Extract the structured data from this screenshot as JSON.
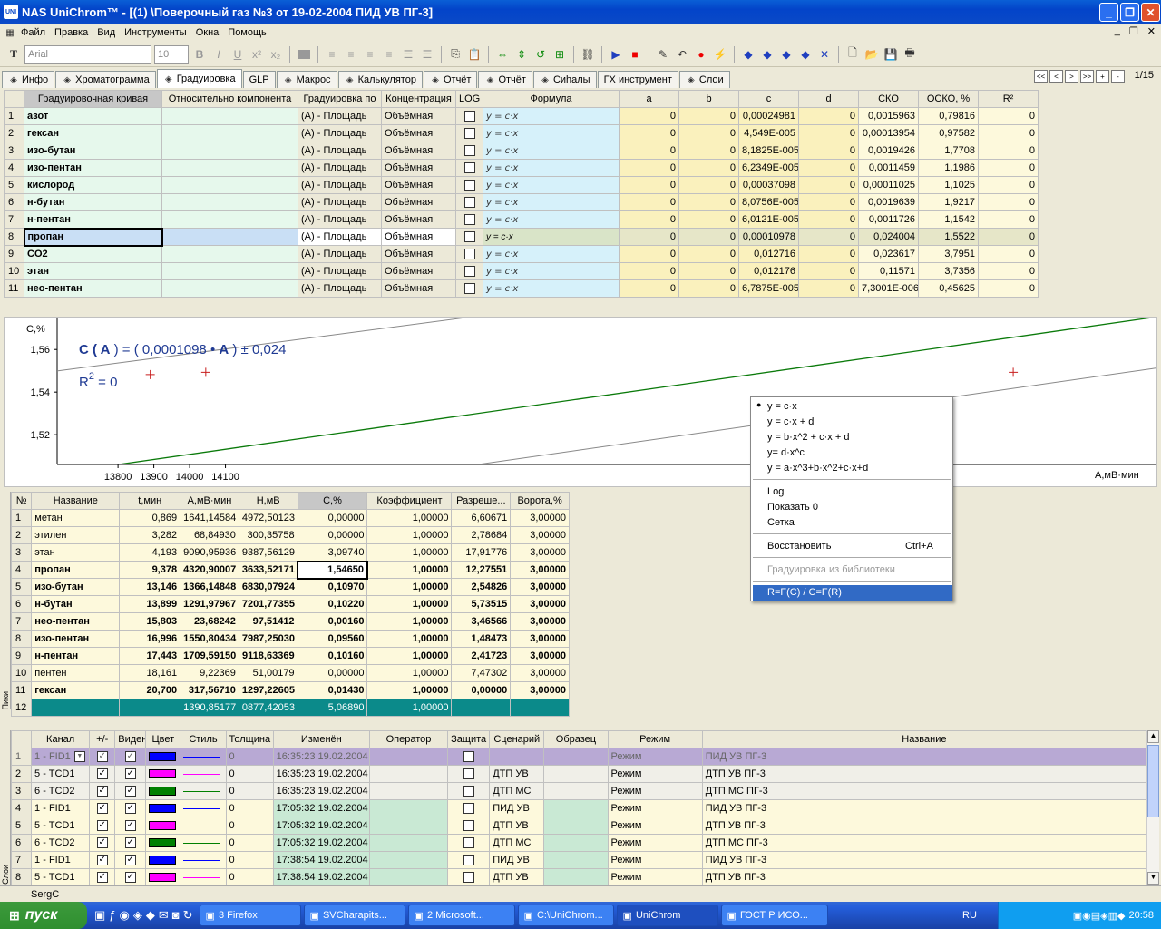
{
  "window": {
    "title": "NAS UniChrom™ - [(1) \\Поверочный газ  №3  от 19-02-2004 ПИД УВ ПГ-3]",
    "app_icon": "UNI"
  },
  "menu": [
    "Файл",
    "Правка",
    "Вид",
    "Инструменты",
    "Окна",
    "Помощь"
  ],
  "toolbar": {
    "font": "Arial",
    "size": "10"
  },
  "tabs": [
    {
      "label": "Инфо",
      "icon": "info-icon",
      "active": false
    },
    {
      "label": "Хроматограмма",
      "icon": "chromatogram-icon",
      "active": false
    },
    {
      "label": "Градуировка",
      "icon": "calibration-icon",
      "active": true
    },
    {
      "label": "GLP",
      "icon": "",
      "active": false
    },
    {
      "label": "Макрос",
      "icon": "macro-icon",
      "active": false
    },
    {
      "label": "Калькулятор",
      "icon": "calculator-icon",
      "active": false
    },
    {
      "label": "Отчёт",
      "icon": "report-icon",
      "active": false
    },
    {
      "label": "Отчёт",
      "icon": "report-icon",
      "active": false
    },
    {
      "label": "Сиhалы",
      "icon": "signals-icon",
      "active": false
    },
    {
      "label": "ГХ инструмент",
      "icon": "",
      "active": false
    },
    {
      "label": "Слои",
      "icon": "layers-icon",
      "active": false
    }
  ],
  "pager": {
    "buttons": [
      "<<",
      "<",
      ">",
      ">>",
      "+",
      "-"
    ],
    "count": "1/15"
  },
  "calib": {
    "headers": [
      "Градуировочная кривая",
      "Относительно компонента",
      "Градуировка по",
      "Концентрация",
      "LOG",
      "Формула",
      "a",
      "b",
      "c",
      "d",
      "СКО",
      "ОСКО, %",
      "R²"
    ],
    "rows": [
      [
        "1",
        "азот",
        "",
        "(A) - Площадь",
        "Объёмная",
        "",
        "y = c·x",
        "0",
        "0",
        "0,00024981",
        "0",
        "0,0015963",
        "0,79816",
        "0"
      ],
      [
        "2",
        "гексан",
        "",
        "(A) - Площадь",
        "Объёмная",
        "",
        "y = c·x",
        "0",
        "0",
        "4,549E-005",
        "0",
        "0,00013954",
        "0,97582",
        "0"
      ],
      [
        "3",
        "изо-бутан",
        "",
        "(A) - Площадь",
        "Объёмная",
        "",
        "y = c·x",
        "0",
        "0",
        "8,1825E-005",
        "0",
        "0,0019426",
        "1,7708",
        "0"
      ],
      [
        "4",
        "изо-пентан",
        "",
        "(A) - Площадь",
        "Объёмная",
        "",
        "y = c·x",
        "0",
        "0",
        "6,2349E-005",
        "0",
        "0,0011459",
        "1,1986",
        "0"
      ],
      [
        "5",
        "кислород",
        "",
        "(A) - Площадь",
        "Объёмная",
        "",
        "y = c·x",
        "0",
        "0",
        "0,00037098",
        "0",
        "0,00011025",
        "1,1025",
        "0"
      ],
      [
        "6",
        "н-бутан",
        "",
        "(A) - Площадь",
        "Объёмная",
        "",
        "y = c·x",
        "0",
        "0",
        "8,0756E-005",
        "0",
        "0,0019639",
        "1,9217",
        "0"
      ],
      [
        "7",
        "н-пентан",
        "",
        "(A) - Площадь",
        "Объёмная",
        "",
        "y = c·x",
        "0",
        "0",
        "6,0121E-005",
        "0",
        "0,0011726",
        "1,1542",
        "0"
      ],
      [
        "8",
        "пропан",
        "",
        "(A) - Площадь",
        "Объёмная",
        "",
        "y = c·x",
        "0",
        "0",
        "0,00010978",
        "0",
        "0,024004",
        "1,5522",
        "0"
      ],
      [
        "9",
        "CO2",
        "",
        "(A) - Площадь",
        "Объёмная",
        "",
        "y = c·x",
        "0",
        "0",
        "0,012716",
        "0",
        "0,023617",
        "3,7951",
        "0"
      ],
      [
        "10",
        "этан",
        "",
        "(A) - Площадь",
        "Объёмная",
        "",
        "y = c·x",
        "0",
        "0",
        "0,012176",
        "0",
        "0,11571",
        "3,7356",
        "0"
      ],
      [
        "11",
        "нео-пентан",
        "",
        "(A) - Площадь",
        "Объёмная",
        "",
        "y = c·x",
        "0",
        "0",
        "6,7875E-005",
        "0",
        "7,3001E-006",
        "0,45625",
        "0"
      ]
    ]
  },
  "chart_data": {
    "type": "scatter",
    "equation_parts": {
      "pre": "C ( ",
      "A1": "A",
      " mid": " ) = ( 0,0001098 • ",
      "A2": "A",
      "post": " ) ± 0,024"
    },
    "r2_text": "R",
    "r2_exp": "2",
    "r2_val": " = 0",
    "ylabel": "C,%",
    "xlabel": "A,мВ·мин",
    "xlim": [
      13630,
      16700
    ],
    "ylim": [
      1.506,
      1.575
    ],
    "xticks": [
      13800,
      13900,
      14000,
      14100
    ],
    "yticks": [
      1.52,
      1.54,
      1.56
    ],
    "lines": [
      {
        "name": "fit",
        "color": "#0a7a0a",
        "points": [
          [
            13630,
            1.5019
          ],
          [
            16700,
            1.5753
          ]
        ]
      },
      {
        "name": "upper",
        "color": "#888888",
        "points": [
          [
            13630,
            1.5499
          ],
          [
            14930,
            1.5785
          ]
        ]
      },
      {
        "name": "lower",
        "color": "#888888",
        "points": [
          [
            13630,
            1.4779
          ],
          [
            16700,
            1.5513
          ]
        ]
      }
    ],
    "points": [
      [
        13890,
        1.5482
      ],
      [
        14045,
        1.5493
      ],
      [
        16300,
        1.5493
      ]
    ],
    "point_color": "#c81e1e"
  },
  "context_menu": {
    "items": [
      "y = c·x",
      "y = c·x + d",
      "y = b·x^2 + c·x + d",
      "y= d·x^c",
      "y = a·x^3+b·x^2+c·x+d",
      "Log",
      "Показать 0",
      "Сетка",
      "Восстановить",
      "Градуировка из библиотеки",
      "R=F(C) / C=F(R)"
    ],
    "shortcut": "Ctrl+A"
  },
  "peaks": {
    "side_label": "Пики",
    "headers": [
      "№",
      "Название",
      "t,мин",
      "A,мВ·мин",
      "H,мВ",
      "C,%",
      "Коэффициент",
      "Разреше...",
      "Ворота,%"
    ],
    "rows": [
      [
        "1",
        "метан",
        "0,869",
        "1641,14584",
        "4972,50123",
        "0,00000",
        "1,00000",
        "6,60671",
        "3,00000"
      ],
      [
        "2",
        "этилен",
        "3,282",
        "68,84930",
        "300,35758",
        "0,00000",
        "1,00000",
        "2,78684",
        "3,00000"
      ],
      [
        "3",
        "этан",
        "4,193",
        "9090,95936",
        "9387,56129",
        "3,09740",
        "1,00000",
        "17,91776",
        "3,00000"
      ],
      [
        "4",
        "пропан",
        "9,378",
        "4320,90007",
        "3633,52171",
        "1,54650",
        "1,00000",
        "12,27551",
        "3,00000"
      ],
      [
        "5",
        "изо-бутан",
        "13,146",
        "1366,14848",
        "6830,07924",
        "0,10970",
        "1,00000",
        "2,54826",
        "3,00000"
      ],
      [
        "6",
        "н-бутан",
        "13,899",
        "1291,97967",
        "7201,77355",
        "0,10220",
        "1,00000",
        "5,73515",
        "3,00000"
      ],
      [
        "7",
        "нео-пентан",
        "15,803",
        "23,68242",
        "97,51412",
        "0,00160",
        "1,00000",
        "3,46566",
        "3,00000"
      ],
      [
        "8",
        "изо-пентан",
        "16,996",
        "1550,80434",
        "7987,25030",
        "0,09560",
        "1,00000",
        "1,48473",
        "3,00000"
      ],
      [
        "9",
        "н-пентан",
        "17,443",
        "1709,59150",
        "9118,63369",
        "0,10160",
        "1,00000",
        "2,41723",
        "3,00000"
      ],
      [
        "10",
        "пентен",
        "18,161",
        "9,22369",
        "51,00179",
        "0,00000",
        "1,00000",
        "7,47302",
        "3,00000"
      ],
      [
        "11",
        "гексан",
        "20,700",
        "317,56710",
        "1297,22605",
        "0,01430",
        "1,00000",
        "0,00000",
        "3,00000"
      ]
    ],
    "total": [
      "12",
      "",
      "",
      "1390,85177",
      "0877,42053",
      "5,06890",
      "1,00000",
      "",
      ""
    ]
  },
  "layers": {
    "side_label": "Слои",
    "headers": [
      "",
      "Канал",
      "+/-",
      "Виден",
      "Цвет",
      "Стиль",
      "Толщина",
      "Изменён",
      "Оператор",
      "Защита",
      "Сценарий",
      "Образец",
      "Режим",
      "Название"
    ],
    "rows": [
      {
        "n": "1",
        "ch": "1 - FID1",
        "color": "#0000ff",
        "w": "0",
        "ts": "16:35:23 19.02.2004",
        "sc": "",
        "mode": "Режим",
        "name": "ПИД УВ ПГ-3"
      },
      {
        "n": "2",
        "ch": "5 - TCD1",
        "color": "#ff00ff",
        "w": "0",
        "ts": "16:35:23 19.02.2004",
        "sc": "ДТП  УВ",
        "mode": "Режим",
        "name": "ДТП УВ ПГ-3"
      },
      {
        "n": "3",
        "ch": "6 - TCD2",
        "color": "#008000",
        "w": "0",
        "ts": "16:35:23 19.02.2004",
        "sc": "ДТП  МС",
        "mode": "Режим",
        "name": "ДТП МС ПГ-3"
      },
      {
        "n": "4",
        "ch": "1 - FID1",
        "color": "#0000ff",
        "w": "0",
        "ts": "17:05:32 19.02.2004",
        "sc": "ПИД  УВ",
        "mode": "Режим",
        "name": "ПИД УВ ПГ-3"
      },
      {
        "n": "5",
        "ch": "5 - TCD1",
        "color": "#ff00ff",
        "w": "0",
        "ts": "17:05:32 19.02.2004",
        "sc": "ДТП  УВ",
        "mode": "Режим",
        "name": "ДТП УВ ПГ-3"
      },
      {
        "n": "6",
        "ch": "6 - TCD2",
        "color": "#008000",
        "w": "0",
        "ts": "17:05:32 19.02.2004",
        "sc": "ДТП  МС",
        "mode": "Режим",
        "name": "ДТП МС ПГ-3"
      },
      {
        "n": "7",
        "ch": "1 - FID1",
        "color": "#0000ff",
        "w": "0",
        "ts": "17:38:54 19.02.2004",
        "sc": "ПИД  УВ",
        "mode": "Режим",
        "name": "ПИД УВ ПГ-3"
      },
      {
        "n": "8",
        "ch": "5 - TCD1",
        "color": "#ff00ff",
        "w": "0",
        "ts": "17:38:54 19.02.2004",
        "sc": "ДТП  УВ",
        "mode": "Режим",
        "name": "ДТП УВ ПГ-3"
      }
    ]
  },
  "status": {
    "text": "SergC"
  },
  "taskbar": {
    "start": "пуск",
    "buttons": [
      "3 Firefox",
      "SVCharapits...",
      "2 Microsoft...",
      "C:\\UniChrom...",
      "UniChrom",
      "ГОСТ Р ИСО..."
    ],
    "lang": "RU",
    "time": "20:58"
  }
}
